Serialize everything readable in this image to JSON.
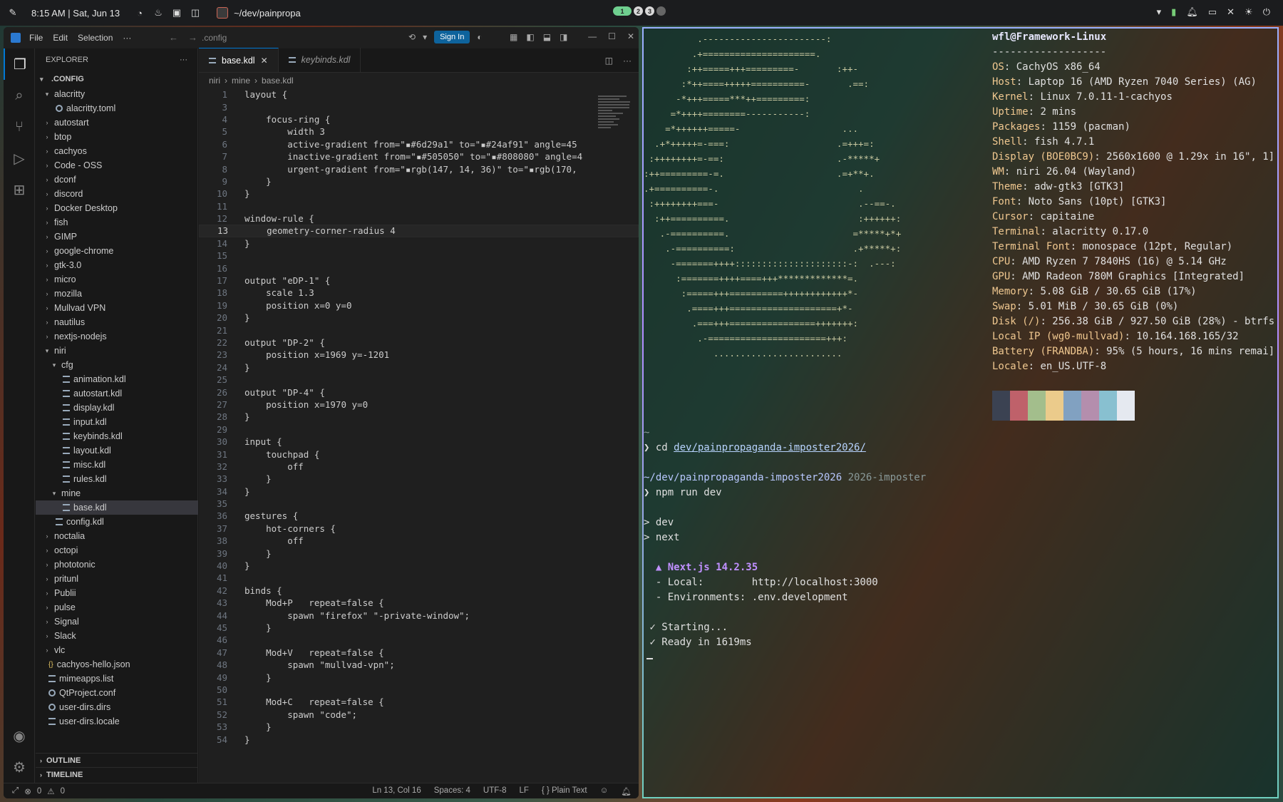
{
  "topbar": {
    "clock": "8:15 AM | Sat, Jun 13",
    "window_title": "~/dev/painpropa",
    "workspaces": [
      "1",
      "2",
      "3"
    ]
  },
  "vscode": {
    "menu": [
      "File",
      "Edit",
      "Selection",
      "···"
    ],
    "command_center": ".config",
    "sign_in": "Sign In",
    "explorer_title": "EXPLORER",
    "explorer_more": "···",
    "root": ".CONFIG",
    "tree": [
      {
        "label": "alacritty",
        "depth": 1,
        "type": "folder-open"
      },
      {
        "label": "alacritty.toml",
        "depth": 2,
        "type": "gear"
      },
      {
        "label": "autostart",
        "depth": 1,
        "type": "folder"
      },
      {
        "label": "btop",
        "depth": 1,
        "type": "folder"
      },
      {
        "label": "cachyos",
        "depth": 1,
        "type": "folder"
      },
      {
        "label": "Code - OSS",
        "depth": 1,
        "type": "folder"
      },
      {
        "label": "dconf",
        "depth": 1,
        "type": "folder"
      },
      {
        "label": "discord",
        "depth": 1,
        "type": "folder"
      },
      {
        "label": "Docker Desktop",
        "depth": 1,
        "type": "folder"
      },
      {
        "label": "fish",
        "depth": 1,
        "type": "folder"
      },
      {
        "label": "GIMP",
        "depth": 1,
        "type": "folder"
      },
      {
        "label": "google-chrome",
        "depth": 1,
        "type": "folder"
      },
      {
        "label": "gtk-3.0",
        "depth": 1,
        "type": "folder"
      },
      {
        "label": "micro",
        "depth": 1,
        "type": "folder"
      },
      {
        "label": "mozilla",
        "depth": 1,
        "type": "folder"
      },
      {
        "label": "Mullvad VPN",
        "depth": 1,
        "type": "folder"
      },
      {
        "label": "nautilus",
        "depth": 1,
        "type": "folder"
      },
      {
        "label": "nextjs-nodejs",
        "depth": 1,
        "type": "folder"
      },
      {
        "label": "niri",
        "depth": 1,
        "type": "folder-open"
      },
      {
        "label": "cfg",
        "depth": 2,
        "type": "folder-open"
      },
      {
        "label": "animation.kdl",
        "depth": 3,
        "type": "file"
      },
      {
        "label": "autostart.kdl",
        "depth": 3,
        "type": "file"
      },
      {
        "label": "display.kdl",
        "depth": 3,
        "type": "file"
      },
      {
        "label": "input.kdl",
        "depth": 3,
        "type": "file"
      },
      {
        "label": "keybinds.kdl",
        "depth": 3,
        "type": "file"
      },
      {
        "label": "layout.kdl",
        "depth": 3,
        "type": "file"
      },
      {
        "label": "misc.kdl",
        "depth": 3,
        "type": "file"
      },
      {
        "label": "rules.kdl",
        "depth": 3,
        "type": "file"
      },
      {
        "label": "mine",
        "depth": 2,
        "type": "folder-open"
      },
      {
        "label": "base.kdl",
        "depth": 3,
        "type": "file",
        "selected": true
      },
      {
        "label": "config.kdl",
        "depth": 2,
        "type": "file"
      },
      {
        "label": "noctalia",
        "depth": 1,
        "type": "folder"
      },
      {
        "label": "octopi",
        "depth": 1,
        "type": "folder"
      },
      {
        "label": "phototonic",
        "depth": 1,
        "type": "folder"
      },
      {
        "label": "pritunl",
        "depth": 1,
        "type": "folder"
      },
      {
        "label": "Publii",
        "depth": 1,
        "type": "folder"
      },
      {
        "label": "pulse",
        "depth": 1,
        "type": "folder"
      },
      {
        "label": "Signal",
        "depth": 1,
        "type": "folder"
      },
      {
        "label": "Slack",
        "depth": 1,
        "type": "folder"
      },
      {
        "label": "vlc",
        "depth": 1,
        "type": "folder"
      },
      {
        "label": "cachyos-hello.json",
        "depth": 1,
        "type": "json"
      },
      {
        "label": "mimeapps.list",
        "depth": 1,
        "type": "file"
      },
      {
        "label": "QtProject.conf",
        "depth": 1,
        "type": "gear"
      },
      {
        "label": "user-dirs.dirs",
        "depth": 1,
        "type": "gear"
      },
      {
        "label": "user-dirs.locale",
        "depth": 1,
        "type": "file"
      }
    ],
    "outline": "OUTLINE",
    "timeline": "TIMELINE",
    "tabs": [
      {
        "label": "base.kdl",
        "active": true,
        "close": "✕"
      },
      {
        "label": "keybinds.kdl",
        "active": false
      }
    ],
    "breadcrumb": [
      "niri",
      "mine",
      "base.kdl"
    ],
    "current_line": 13,
    "code": [
      "layout {",
      "",
      "    focus-ring {",
      "        width 3",
      "        active-gradient from=\"▪#6d29a1\" to=\"▪#24af91\" angle=45",
      "        inactive-gradient from=\"▪#505050\" to=\"▪#808080\" angle=4",
      "        urgent-gradient from=\"▪rgb(147, 14, 36)\" to=\"▪rgb(170,",
      "    }",
      "}",
      "",
      "window-rule {",
      "    geometry-corner-radius 4",
      "}",
      "",
      "",
      "output \"eDP-1\" {",
      "    scale 1.3",
      "    position x=0 y=0",
      "}",
      "",
      "output \"DP-2\" {",
      "    position x=1969 y=-1201",
      "}",
      "",
      "output \"DP-4\" {",
      "    position x=1970 y=0",
      "}",
      "",
      "input {",
      "    touchpad {",
      "        off",
      "    }",
      "}",
      "",
      "gestures {",
      "    hot-corners {",
      "        off",
      "    }",
      "}",
      "",
      "binds {",
      "    Mod+P   repeat=false {",
      "        spawn \"firefox\" \"-private-window\";",
      "    }",
      "",
      "    Mod+V   repeat=false {",
      "        spawn \"mullvad-vpn\";",
      "    }",
      "",
      "    Mod+C   repeat=false {",
      "        spawn \"code\";",
      "    }",
      "}"
    ],
    "line_numbers": [
      1,
      3,
      4,
      5,
      6,
      7,
      8,
      9,
      10,
      11,
      12,
      13,
      14,
      15,
      16,
      17,
      18,
      19,
      20,
      21,
      22,
      23,
      24,
      25,
      26,
      27,
      28,
      29,
      30,
      31,
      32,
      33,
      34,
      35,
      36,
      37,
      38,
      39,
      40,
      41,
      42,
      43,
      44,
      45,
      46,
      47,
      48,
      49,
      50,
      51,
      52,
      53,
      54
    ],
    "status": {
      "errors": "0",
      "warnings": "0",
      "position": "Ln 13, Col 16",
      "spaces": "Spaces: 4",
      "encoding": "UTF-8",
      "eol": "LF",
      "language": "{ } Plain Text"
    }
  },
  "terminal": {
    "ascii": [
      "          .-----------------------:",
      "         .+=====================.",
      "        :++=====+++=========-       :++-",
      "       :*++====+++++==========-       .==:",
      "      -*+++=====***++=========:",
      "     =*++++========-----------:",
      "    =*++++++=====-                   ...",
      "  .+*+++++=-===:                    .=+++=:",
      " :++++++++=-==:                     .-*****+",
      ":++=========-=.                     .=+**+.",
      ".+==========-.                          .",
      " :++++++++===-                          .--==-.",
      "  :++==========.                        :++++++:",
      "   .-==========.                       =*****+*+",
      "    .-==========:                      .+*****+:",
      "     -=======++++:::::::::::::::::::::-:  .---:",
      "      :=======++++====+++*************=.",
      "       :=====+++==========++++++++++++*-",
      "        .====+++====================+*-",
      "         .===+++================+++++++:",
      "          .-======================+++:",
      "             ........................"
    ],
    "sysinfo": [
      {
        "head": "wfl@Framework-Linux"
      },
      {
        "sep": "-------------------"
      },
      {
        "k": "OS",
        "v": "CachyOS x86_64"
      },
      {
        "k": "Host",
        "v": "Laptop 16 (AMD Ryzen 7040 Series) (AG)"
      },
      {
        "k": "Kernel",
        "v": "Linux 7.0.11-1-cachyos"
      },
      {
        "k": "Uptime",
        "v": "2 mins"
      },
      {
        "k": "Packages",
        "v": "1159 (pacman)"
      },
      {
        "k": "Shell",
        "v": "fish 4.7.1"
      },
      {
        "k": "Display (BOE0BC9)",
        "v": "2560x1600 @ 1.29x in 16\", 1]"
      },
      {
        "k": "WM",
        "v": "niri 26.04 (Wayland)"
      },
      {
        "k": "Theme",
        "v": "adw-gtk3 [GTK3]"
      },
      {
        "k": "Font",
        "v": "Noto Sans (10pt) [GTK3]"
      },
      {
        "k": "Cursor",
        "v": "capitaine"
      },
      {
        "k": "Terminal",
        "v": "alacritty 0.17.0"
      },
      {
        "k": "Terminal Font",
        "v": "monospace (12pt, Regular)"
      },
      {
        "k": "CPU",
        "v": "AMD Ryzen 7 7840HS (16) @ 5.14 GHz"
      },
      {
        "k": "GPU",
        "v": "AMD Radeon 780M Graphics [Integrated]"
      },
      {
        "k": "Memory",
        "v": "5.08 GiB / 30.65 GiB (17%)"
      },
      {
        "k": "Swap",
        "v": "5.01 MiB / 30.65 GiB (0%)"
      },
      {
        "k": "Disk (/)",
        "v": "256.38 GiB / 927.50 GiB (28%) - btrfs"
      },
      {
        "k": "Local IP (wg0-mullvad)",
        "v": "10.164.168.165/32"
      },
      {
        "k": "Battery (FRANDBA)",
        "v": "95% (5 hours, 16 mins remai]"
      },
      {
        "k": "Locale",
        "v": "en_US.UTF-8"
      }
    ],
    "palette": [
      "#3b4252",
      "#bf616a",
      "#a3be8c",
      "#ebcb8b",
      "#81a1c1",
      "#b48ead",
      "#88c0d0",
      "#e5e9f0"
    ],
    "session": {
      "tilde": "~",
      "prompt1": "❯ cd ",
      "cd_path": "dev/painpropaganda-imposter2026/",
      "cwd": "~/dev/painpropaganda-imposter2026",
      "branch": " 2026-imposter",
      "prompt2": "❯ npm run dev",
      "script1": "> dev",
      "script2": "> next",
      "nextjs": "  ▲ Next.js 14.2.35",
      "local": "  - Local:        http://localhost:3000",
      "envs": "  - Environments: .env.development",
      "starting": " ✓ Starting...",
      "ready": " ✓ Ready in 1619ms"
    }
  }
}
